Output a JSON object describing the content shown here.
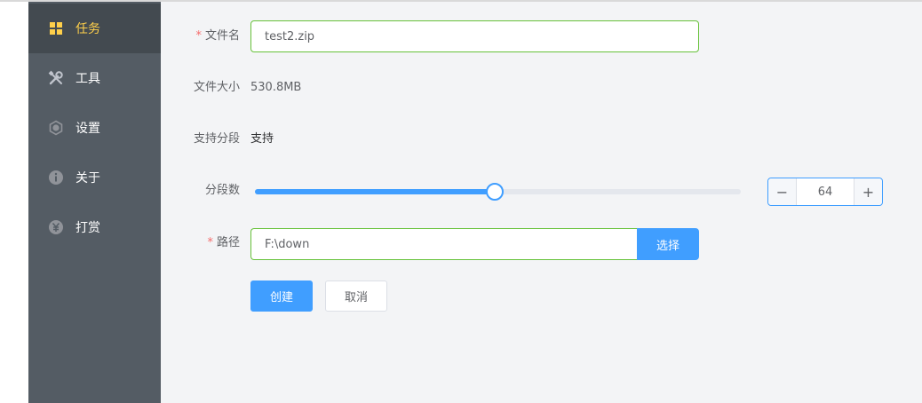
{
  "sidebar": {
    "items": [
      {
        "label": "任务",
        "icon": "grid-icon",
        "active": true
      },
      {
        "label": "工具",
        "icon": "tools-icon",
        "active": false
      },
      {
        "label": "设置",
        "icon": "gear-icon",
        "active": false
      },
      {
        "label": "关于",
        "icon": "info-icon",
        "active": false
      },
      {
        "label": "打赏",
        "icon": "yen-icon",
        "active": false
      }
    ]
  },
  "form": {
    "filename": {
      "label": "文件名",
      "required_mark": "*",
      "value": "test2.zip"
    },
    "filesize": {
      "label": "文件大小",
      "value": "530.8MB"
    },
    "segment_support": {
      "label": "支持分段",
      "value": "支持"
    },
    "segments": {
      "label": "分段数",
      "value": "64",
      "slider_fraction": 0.493,
      "dec": "−",
      "inc": "+"
    },
    "path": {
      "label": "路径",
      "required_mark": "*",
      "value": "F:\\down",
      "select_button": "选择"
    },
    "create_button": "创建",
    "cancel_button": "取消"
  },
  "colors": {
    "sidebar_bg": "#545c64",
    "sidebar_active_bg": "#434a50",
    "active_text": "#ffd04b",
    "primary": "#409eff",
    "success_border": "#67c23a",
    "required": "#f56c6c"
  }
}
